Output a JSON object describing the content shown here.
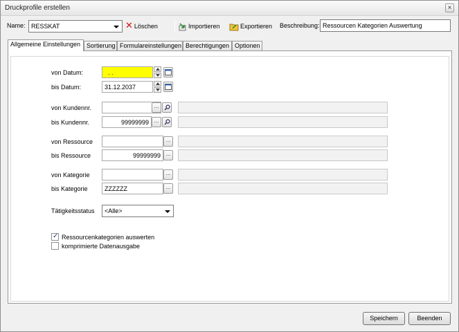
{
  "window": {
    "title": "Druckprofile erstellen",
    "close_glyph": "×"
  },
  "toolbar": {
    "name_label": "Name:",
    "name_value": "RESSKAT",
    "delete_label": "Löschen",
    "import_label": "Importieren",
    "export_label": "Exportieren",
    "description_label": "Beschreibung:",
    "description_value": "Ressourcen Kategorien Auswertung"
  },
  "tabs": [
    {
      "label": "Allgemeine Einstellungen",
      "active": true
    },
    {
      "label": "Sortierung"
    },
    {
      "label": "Formulareinstellungen"
    },
    {
      "label": "Berechtigungen"
    },
    {
      "label": "Optionen"
    }
  ],
  "form": {
    "date_from_label": "von Datum:",
    "date_from_value": ". .",
    "date_to_label": "bis Datum:",
    "date_to_value": "31.12.2037",
    "customer_from_label": "von Kundennr.",
    "customer_from_value": "",
    "customer_to_label": "bis Kundennr.",
    "customer_to_value": "99999999",
    "resource_from_label": "von Ressource",
    "resource_from_value": "",
    "resource_to_label": "bis Ressource",
    "resource_to_value": "99999999",
    "category_from_label": "von Kategorie",
    "category_from_value": "",
    "category_to_label": "bis Kategorie",
    "category_to_value": "ZZZZZZ",
    "activity_label": "Tätigkeitsstatus",
    "activity_value": "<Alle>",
    "browse_glyph": "...",
    "check_eval_label": "Ressourcenkategorien auswerten",
    "check_eval_checked": true,
    "check_compressed_label": "komprimierte Datenausgabe",
    "check_compressed_checked": false
  },
  "buttons": {
    "save": "Speichern",
    "close": "Beenden"
  },
  "colors": {
    "highlight_field": "#ffff00",
    "delete_icon": "#d01010"
  }
}
